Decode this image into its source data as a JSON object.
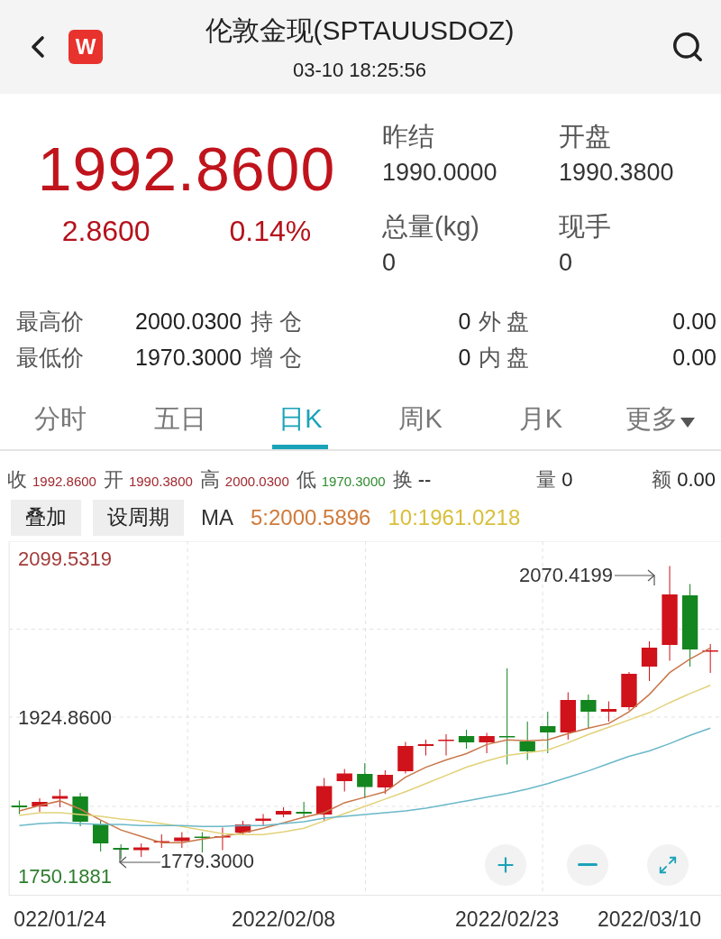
{
  "header": {
    "title": "伦敦金现(SPTAUUSDOZ)",
    "time": "03-10 18:25:56",
    "logo": "W"
  },
  "quote": {
    "price": "1992.8600",
    "change": "2.8600",
    "change_pct": "0.14%"
  },
  "summary": [
    {
      "label": "昨结",
      "value": "1990.0000"
    },
    {
      "label": "开盘",
      "value": "1990.3800"
    },
    {
      "label": "总量(kg)",
      "value": "0"
    },
    {
      "label": "现手",
      "value": "0"
    }
  ],
  "stats": [
    {
      "label": "最高价",
      "value": "2000.0300",
      "label_2": "持 仓",
      "value_2": "0",
      "label_3": "外 盘",
      "value_3": "0.00"
    },
    {
      "label": "最低价",
      "value": "1970.3000",
      "label_2": "增 仓",
      "value_2": "0",
      "label_3": "内 盘",
      "value_3": "0.00"
    }
  ],
  "tabs": [
    {
      "label": "分时",
      "selected": false,
      "dropdown": false
    },
    {
      "label": "五日",
      "selected": false,
      "dropdown": false
    },
    {
      "label": "日K",
      "selected": true,
      "dropdown": false
    },
    {
      "label": "周K",
      "selected": false,
      "dropdown": false
    },
    {
      "label": "月K",
      "selected": false,
      "dropdown": false
    },
    {
      "label": "更多",
      "selected": false,
      "dropdown": true
    }
  ],
  "ohlc": [
    {
      "label": "收",
      "value": "1992.8600",
      "color": "#a0282e"
    },
    {
      "label": "开",
      "value": "1990.3800",
      "color": "#a0282e"
    },
    {
      "label": "高",
      "value": "2000.0300",
      "color": "#a0282e"
    },
    {
      "label": "低",
      "value": "1970.3000",
      "color": "#2e8b2e"
    },
    {
      "label": "换",
      "value": "--",
      "color": "#222222"
    },
    {
      "label": "量",
      "value": "0",
      "color": "#222222"
    },
    {
      "label": "额",
      "value": "0.00",
      "color": "#222222"
    }
  ],
  "buttons": [
    "叠加",
    "设周期"
  ],
  "ma": {
    "label": "MA",
    "lines": [
      {
        "text": "5:2000.5896",
        "color": "#d07a3a"
      },
      {
        "text": "10:1961.0218",
        "color": "#d8bf3a"
      }
    ]
  },
  "chart": {
    "high_mark": "2070.4199",
    "low_mark": "1779.3000",
    "chart_data": {
      "type": "line",
      "categories": [
        null,
        null,
        "022/01/24",
        null,
        null,
        null,
        null,
        null,
        null,
        null,
        null,
        null,
        null,
        "2022/02/08",
        null,
        null,
        null,
        null,
        null,
        null,
        null,
        null,
        null,
        null,
        "2022/02/23",
        null,
        null,
        null,
        null,
        null,
        null,
        "2022/03/10",
        null,
        null,
        null
      ],
      "ylim": [
        1730.3,
        2119.4
      ],
      "yticks": [
        {
          "value": 2099.5319,
          "label": "2099.5319"
        },
        {
          "value": 1924.86,
          "label": "1924.8600"
        },
        {
          "value": 1750.1881,
          "label": "1750.1881"
        }
      ],
      "series": [
        {
          "color": "#c9774a",
          "values": [
            1823,
            1829,
            1834,
            1825,
            1813,
            1802,
            1795,
            1788,
            1788,
            1792,
            1795,
            1799,
            1804,
            1810,
            1816,
            1821,
            1832,
            1838,
            1844,
            1860,
            1871,
            1879,
            1886,
            1896,
            1901,
            1900,
            1901,
            1908,
            1914,
            1919,
            1932,
            1951,
            1975,
            1990,
            2002
          ]
        },
        {
          "color": "#e2d27a",
          "values": [
            1818,
            1821,
            1821,
            1819,
            1817,
            1814,
            1812,
            1809,
            1806,
            1802,
            1798,
            1797,
            1797,
            1800,
            1804,
            1812,
            1820,
            1828,
            1836,
            1844,
            1853,
            1862,
            1871,
            1878,
            1884,
            1887,
            1890,
            1898,
            1907,
            1915,
            1923,
            1931,
            1942,
            1952,
            1961
          ]
        },
        {
          "color": "#6ab8c8",
          "values": [
            1807,
            1809,
            1810,
            1809,
            1808,
            1808,
            1807,
            1807,
            1807,
            1806,
            1806,
            1807,
            1807,
            1809,
            1811,
            1815,
            1817,
            1819,
            1821,
            1823,
            1826,
            1830,
            1834,
            1838,
            1842,
            1847,
            1853,
            1860,
            1867,
            1875,
            1883,
            1889,
            1897,
            1906,
            1914
          ]
        }
      ]
    }
  }
}
